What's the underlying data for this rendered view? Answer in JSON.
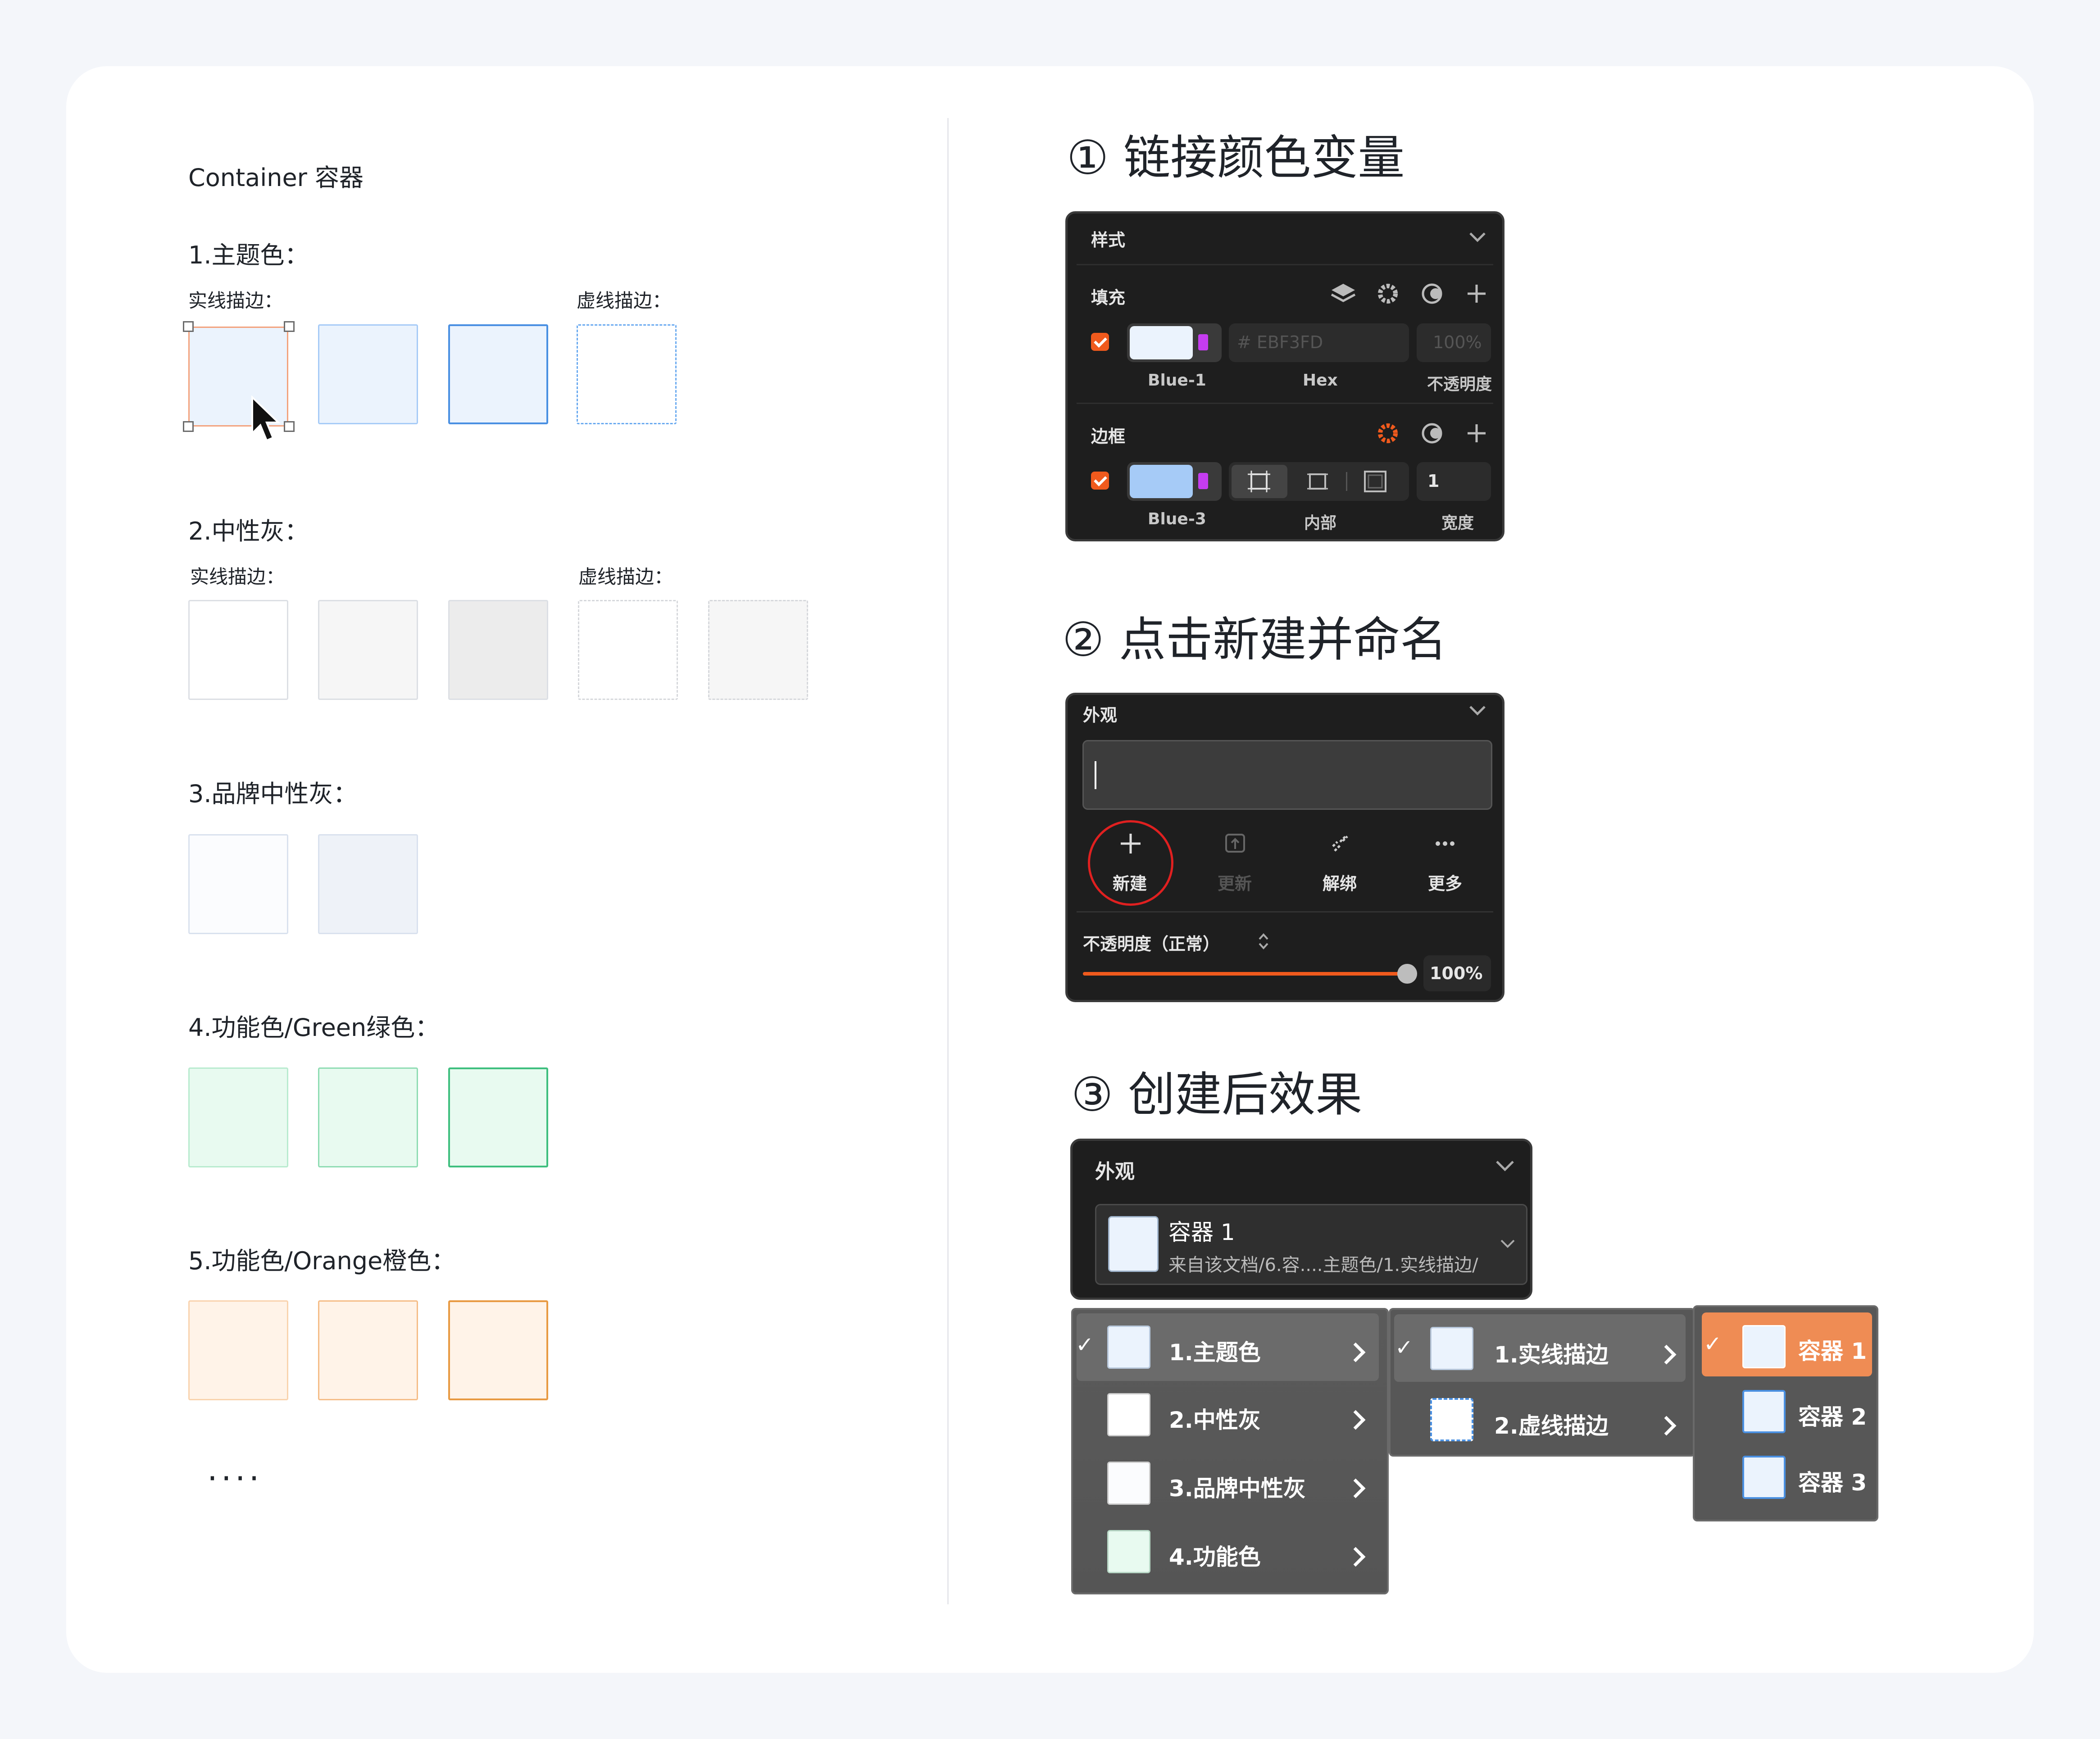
{
  "left": {
    "title": "Container 容器",
    "sections": [
      {
        "label": "1.主题色：",
        "solid_label": "实线描边：",
        "dashed_label": "虚线描边："
      },
      {
        "label": "2.中性灰：",
        "solid_label": "实线描边：",
        "dashed_label": "虚线描边："
      },
      {
        "label": "3.品牌中性灰："
      },
      {
        "label": "4.功能色/Green绿色："
      },
      {
        "label": "5.功能色/Orange橙色："
      }
    ],
    "ellipsis": "····"
  },
  "steps": [
    {
      "title": "① 链接颜色变量"
    },
    {
      "title": "② 点击新建并命名"
    },
    {
      "title": "③ 创建后效果"
    }
  ],
  "style_panel": {
    "header": "样式",
    "fill_label": "填充",
    "fill_hex": "# EBF3FD",
    "fill_opacity": "100%",
    "fill_var": "Blue-1",
    "hex_caption": "Hex",
    "opacity_caption": "不透明度",
    "border_label": "边框",
    "border_var": "Blue-3",
    "border_pos_caption": "内部",
    "border_width": "1",
    "width_caption": "宽度",
    "colors": {
      "fill": "#ebf3fd",
      "border": "#a6cbf7",
      "accent": "#f05a1d"
    }
  },
  "appearance_panel": {
    "header": "外观",
    "actions": [
      "新建",
      "更新",
      "解绑",
      "更多"
    ],
    "opacity_label": "不透明度（正常）",
    "opacity_value": "100%",
    "opacity_fraction": 1.0
  },
  "result_panel": {
    "header": "外观",
    "style_name": "容器 1",
    "style_path": "来自该文档/6.容....主题色/1.实线描边/"
  },
  "menus": {
    "level1": [
      {
        "label": "1.主题色",
        "selected": true,
        "color": "#ebf3fd"
      },
      {
        "label": "2.中性灰",
        "selected": false,
        "color": "#ffffff"
      },
      {
        "label": "3.品牌中性灰",
        "selected": false,
        "color": "#fbfcfe"
      },
      {
        "label": "4.功能色",
        "selected": false,
        "color": "#e8faf0"
      }
    ],
    "level2": [
      {
        "label": "1.实线描边",
        "selected": true
      },
      {
        "label": "2.虚线描边",
        "selected": false
      }
    ],
    "level3": [
      {
        "label": "容器 1",
        "selected": true
      },
      {
        "label": "容器 2",
        "selected": false
      },
      {
        "label": "容器 3",
        "selected": false
      }
    ]
  }
}
